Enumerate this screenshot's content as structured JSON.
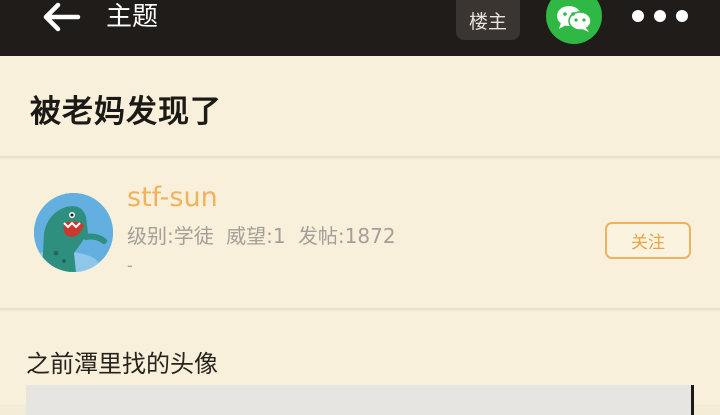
{
  "header": {
    "back_icon": "arrow-left-icon",
    "title": "主题",
    "owner_label": "楼主",
    "wechat_icon": "wechat-icon",
    "more_icon": "more-dots-icon",
    "bg_color": "#1f1c1a",
    "wechat_color": "#2fb844"
  },
  "post": {
    "title": "被老妈发现了"
  },
  "author": {
    "name": "stf-sun",
    "level": "级别:学徒",
    "reputation": "威望:1",
    "posts": "发帖:1872",
    "signature": "-",
    "follow_label": "关注",
    "accent_color": "#f0b25d"
  },
  "content": {
    "text": "之前潭里找的头像"
  }
}
